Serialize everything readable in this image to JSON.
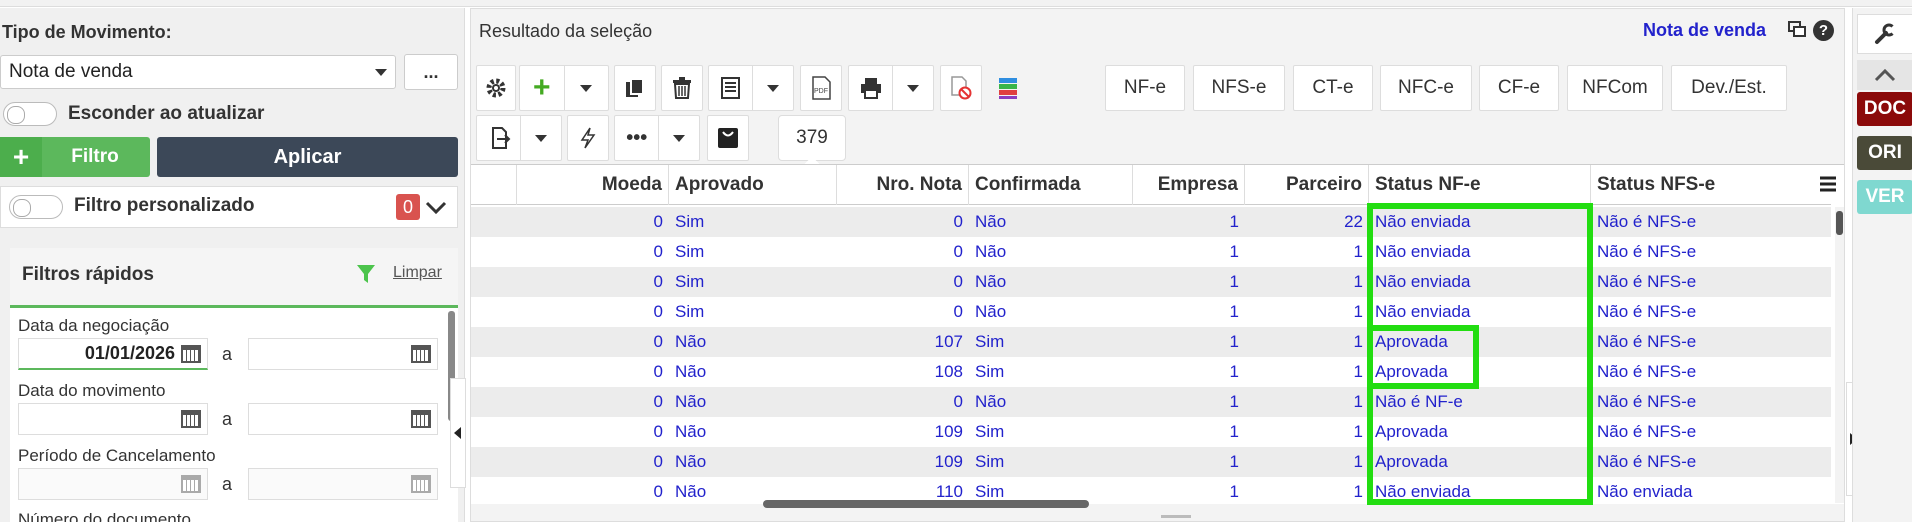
{
  "left": {
    "tipo_label": "Tipo de Movimento:",
    "tipo_value": "Nota de venda",
    "more_button": "...",
    "esconder_label": "Esconder ao atualizar",
    "filtro_button": "Filtro",
    "aplicar_button": "Aplicar",
    "filtro_personalizado_label": "Filtro personalizado",
    "filtro_count": "0",
    "filtros_rapidos_title": "Filtros rápidos",
    "limpar_link": "Limpar",
    "data_negociacao_label": "Data da negociação",
    "data_negociacao_from": "01/01/2026",
    "a1": "a",
    "data_movimento_label": "Data do movimento",
    "a2": "a",
    "periodo_cancelamento_label": "Período de Cancelamento",
    "a3": "a",
    "numero_documento_label": "Número do documento"
  },
  "center": {
    "title": "Resultado da seleção",
    "nota_link": "Nota de venda",
    "toolbar_buttons": [
      "NF-e",
      "NFS-e",
      "CT-e",
      "NFC-e",
      "CF-e",
      "NFCom",
      "Dev./Est."
    ],
    "record_count": "379"
  },
  "grid": {
    "columns": [
      "Moeda",
      "Aprovado",
      "Nro. Nota",
      "Confirmada",
      "Empresa",
      "Parceiro",
      "Status NF-e",
      "Status NFS-e"
    ],
    "rows": [
      [
        "0",
        "Sim",
        "0",
        "Não",
        "1",
        "22",
        "Não enviada",
        "Não é NFS-e"
      ],
      [
        "0",
        "Sim",
        "0",
        "Não",
        "1",
        "1",
        "Não enviada",
        "Não é NFS-e"
      ],
      [
        "0",
        "Sim",
        "0",
        "Não",
        "1",
        "1",
        "Não enviada",
        "Não é NFS-e"
      ],
      [
        "0",
        "Sim",
        "0",
        "Não",
        "1",
        "1",
        "Não enviada",
        "Não é NFS-e"
      ],
      [
        "0",
        "Não",
        "107",
        "Sim",
        "1",
        "1",
        "Aprovada",
        "Não é NFS-e"
      ],
      [
        "0",
        "Não",
        "108",
        "Sim",
        "1",
        "1",
        "Aprovada",
        "Não é NFS-e"
      ],
      [
        "0",
        "Não",
        "0",
        "Não",
        "1",
        "1",
        "Não é NF-e",
        "Não é NFS-e"
      ],
      [
        "0",
        "Não",
        "109",
        "Sim",
        "1",
        "1",
        "Aprovada",
        "Não é NFS-e"
      ],
      [
        "0",
        "Não",
        "109",
        "Sim",
        "1",
        "1",
        "Aprovada",
        "Não é NFS-e"
      ],
      [
        "0",
        "Não",
        "110",
        "Sim",
        "1",
        "1",
        "Não enviada",
        "Não enviada"
      ]
    ]
  },
  "right": {
    "doc_badge": "DOC",
    "ori_badge": "ORI",
    "ver_badge": "VER"
  },
  "colors": {
    "accent_green": "#5cb85c",
    "dark_button": "#3c4858",
    "link_blue": "#2222cc",
    "highlight_green": "#22dd11",
    "doc_red": "#8b0a0a",
    "ori_olive": "#4a4a38",
    "ver_teal": "#7fd8d0"
  }
}
